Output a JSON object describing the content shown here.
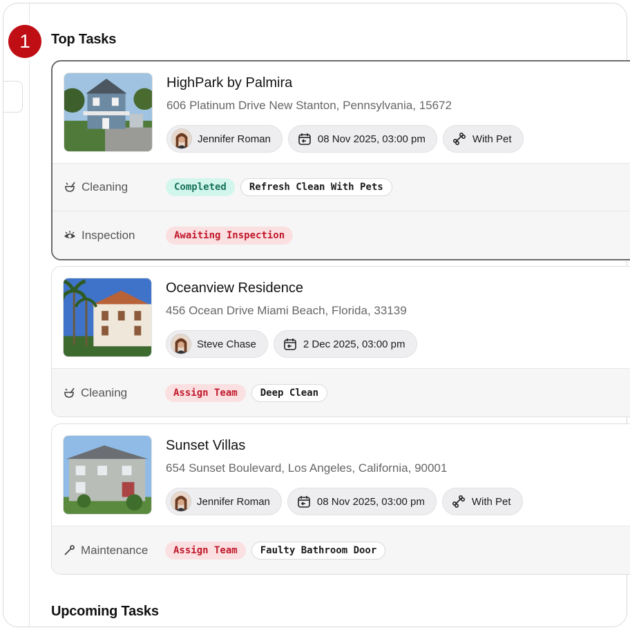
{
  "step_number": "1",
  "sections": {
    "top_title": "Top Tasks",
    "upcoming_title": "Upcoming Tasks"
  },
  "colors": {
    "accent": "#c00e15",
    "completed_bg": "#d3f6ec",
    "completed_text": "#17735a",
    "alert_bg": "#fbe0e2",
    "alert_text": "#c0182a"
  },
  "tasks": [
    {
      "name": "HighPark by Palmira",
      "address": "606 Platinum Drive New Stanton, Pennsylvania, 15672",
      "assignee": "Jennifer Roman",
      "datetime": "08 Nov 2025, 03:00 pm",
      "extra": "With Pet",
      "extra_icon": "bone-icon",
      "rows": [
        {
          "category": "Cleaning",
          "icon": "cleaning-icon",
          "status": "Completed",
          "status_tone": "green",
          "service": "Refresh Clean With Pets"
        },
        {
          "category": "Inspection",
          "icon": "eye-icon",
          "status": "Awaiting Inspection",
          "status_tone": "red"
        }
      ]
    },
    {
      "name": "Oceanview Residence",
      "address": "456 Ocean Drive Miami Beach, Florida, 33139",
      "assignee": "Steve Chase",
      "datetime": "2 Dec 2025, 03:00 pm",
      "rows": [
        {
          "category": "Cleaning",
          "icon": "cleaning-icon",
          "status": "Assign Team",
          "status_tone": "red",
          "service": "Deep Clean"
        }
      ]
    },
    {
      "name": "Sunset Villas",
      "address": "654 Sunset Boulevard, Los Angeles, California, 90001",
      "assignee": "Jennifer Roman",
      "datetime": "08 Nov 2025, 03:00 pm",
      "extra": "With Pet",
      "extra_icon": "bone-icon",
      "rows": [
        {
          "category": "Maintenance",
          "icon": "wrench-icon",
          "status": "Assign Team",
          "status_tone": "red",
          "service": "Faulty Bathroom Door"
        }
      ]
    }
  ]
}
